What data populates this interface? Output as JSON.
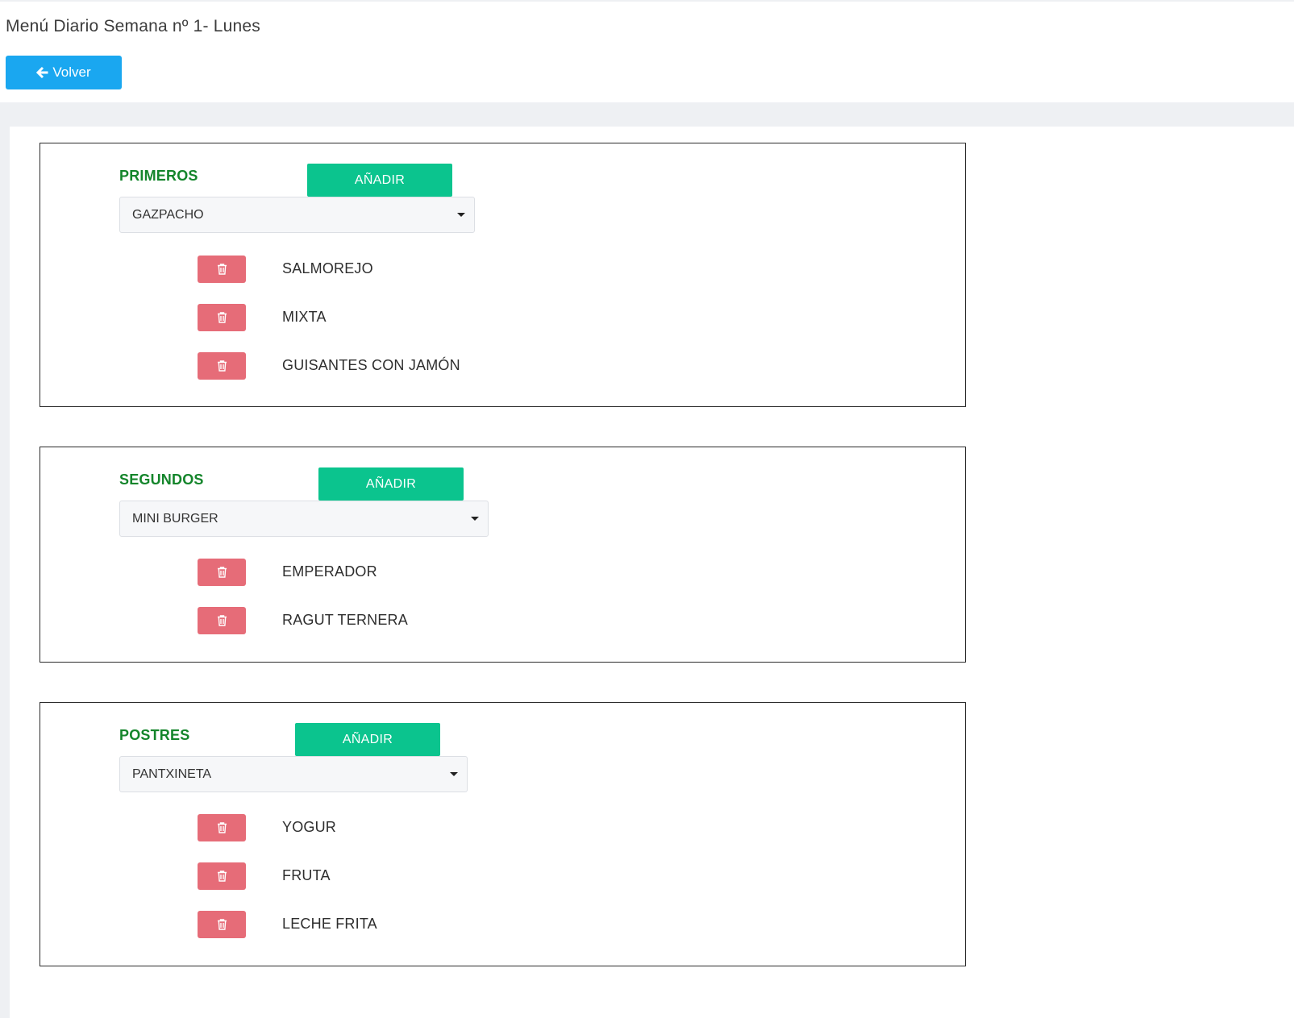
{
  "header": {
    "title": "Menú Diario Semana nº 1- Lunes",
    "back_label": "Volver"
  },
  "colors": {
    "primary": "#1aa7f0",
    "success": "#0bc48e",
    "danger": "#e66c78",
    "section_title": "#14852b"
  },
  "icons": {
    "back": "arrow-left-icon",
    "delete": "trash-icon",
    "select": "caret-down-icon"
  },
  "sections": [
    {
      "title": "PRIMEROS",
      "add_label": "AÑADIR",
      "selected": "GAZPACHO",
      "items": [
        "SALMOREJO",
        "MIXTA",
        "GUISANTES CON JAMÓN"
      ]
    },
    {
      "title": "SEGUNDOS",
      "add_label": "AÑADIR",
      "selected": "MINI BURGER",
      "items": [
        "EMPERADOR",
        "RAGUT TERNERA"
      ]
    },
    {
      "title": "POSTRES",
      "add_label": "AÑADIR",
      "selected": "PANTXINETA",
      "items": [
        "YOGUR",
        "FRUTA",
        "LECHE FRITA"
      ]
    }
  ]
}
